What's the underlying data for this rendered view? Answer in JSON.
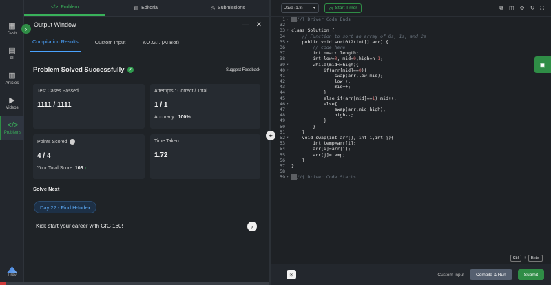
{
  "left_nav": {
    "items": [
      {
        "label": "Dash",
        "icon": "grid-icon",
        "glyph": "▦"
      },
      {
        "label": "All",
        "icon": "list-icon",
        "glyph": "▤"
      },
      {
        "label": "Articles",
        "icon": "book-icon",
        "glyph": "▥"
      },
      {
        "label": "Videos",
        "icon": "video-icon",
        "glyph": "▶"
      },
      {
        "label": "Problems",
        "icon": "code-icon",
        "glyph": "</>"
      }
    ],
    "prev_label": "Prev"
  },
  "problem_tabs": [
    {
      "label": "Problem",
      "glyph": "</>"
    },
    {
      "label": "Editorial",
      "glyph": "▤"
    },
    {
      "label": "Submissions",
      "glyph": "◷"
    }
  ],
  "output_window": {
    "title": "Output Window",
    "tabs": [
      "Compilation Results",
      "Custom Input",
      "Y.O.G.I. (AI Bot)"
    ],
    "result_title": "Problem Solved Successfully",
    "feedback_link": "Suggest Feedback",
    "cards": {
      "test_cases": {
        "label": "Test Cases Passed",
        "value": "1111 / 1111"
      },
      "attempts": {
        "label": "Attempts : Correct / Total",
        "value": "1 / 1",
        "accuracy_label": "Accuracy :",
        "accuracy_value": "100%"
      },
      "points": {
        "label": "Points Scored",
        "value": "4 / 4",
        "total_label": "Your Total Score:",
        "total_value": "108"
      },
      "time": {
        "label": "Time Taken",
        "value": "1.72"
      }
    },
    "solve_next_title": "Solve Next",
    "next_pill": "Day 22 - Find H-Index",
    "kick_text": "Kick start your career with GfG 160!"
  },
  "editor": {
    "language": "Java (1.8)",
    "timer_label": "Start Timer",
    "line_numbers": [
      "1",
      "32",
      "33",
      "34",
      "35",
      "36",
      "37",
      "38",
      "39",
      "40",
      "41",
      "42",
      "43",
      "44",
      "45",
      "46",
      "47",
      "48",
      "49",
      "50",
      "51",
      "52",
      "53",
      "54",
      "55",
      "56",
      "57",
      "58",
      "59"
    ],
    "code_lines": [
      "//} Driver Code Ends",
      "",
      "class Solution {",
      "    // Function to sort an array of 0s, 1s, and 2s",
      "    public void sort012(int[] arr) {",
      "        // code here",
      "        int n=arr.length;",
      "        int low=0, mid=0,high=n-1;",
      "        while(mid<=high){",
      "            if(arr[mid]==0){",
      "                swap(arr,low,mid);",
      "                low++;",
      "                mid++;",
      "            }",
      "            else if(arr[mid]==1) mid++;",
      "            else{",
      "                swap(arr,mid,high);",
      "                high--;",
      "            }",
      "        }",
      "    }",
      "    void swap(int arr[], int i,int j){",
      "        int temp=arr[i];",
      "        arr[i]=arr[j];",
      "        arr[j]=temp;",
      "    }",
      "}",
      "",
      "//{ Driver Code Starts"
    ],
    "shortcut_keys": [
      "Ctrl",
      "+",
      "Enter"
    ],
    "custom_input": "Custom Input",
    "compile_label": "Compile & Run",
    "submit_label": "Submit"
  }
}
